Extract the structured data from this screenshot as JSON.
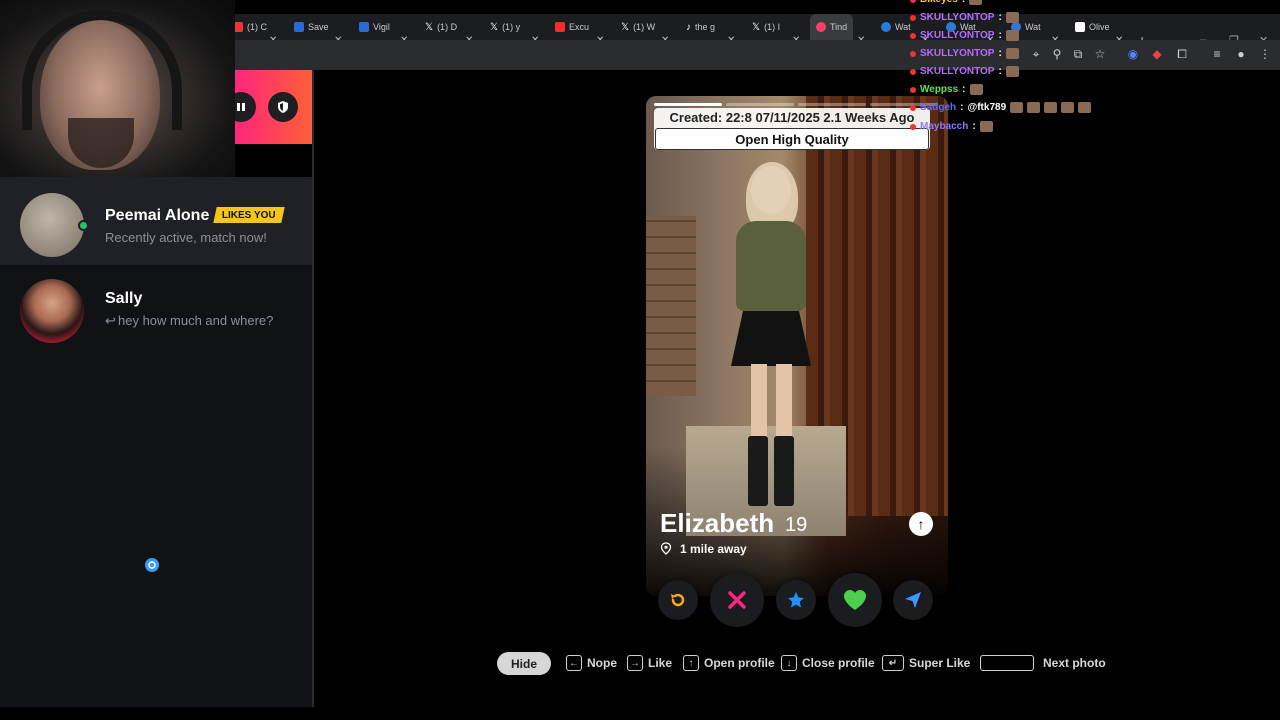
{
  "browser": {
    "tabs": [
      {
        "label": "(1) C",
        "favicon_color": "#e33"
      },
      {
        "label": "Save",
        "favicon_color": "#2a6ad6"
      },
      {
        "label": "Vigil",
        "favicon_color": "#2a6ad6"
      },
      {
        "label": "(1) D",
        "favicon_color": "#ffffff"
      },
      {
        "label": "(1) y",
        "favicon_color": "#ffffff"
      },
      {
        "label": "Excu",
        "favicon_color": "#ff2a2a"
      },
      {
        "label": "(1) W",
        "favicon_color": "#ffffff"
      },
      {
        "label": "the g",
        "favicon_color": "#111111"
      },
      {
        "label": "(1) I",
        "favicon_color": "#ffffff"
      },
      {
        "label": "Tind",
        "favicon_color": "#fe3c72"
      },
      {
        "label": "Wat",
        "favicon_color": "#2a7ad6"
      },
      {
        "label": "Wat",
        "favicon_color": "#2a7ad6"
      },
      {
        "label": "Wat",
        "favicon_color": "#2a7ad6"
      },
      {
        "label": "Olive",
        "favicon_color": "#ffffff"
      }
    ],
    "new_tab": "+",
    "window_controls": [
      "–",
      "❐",
      "✕"
    ]
  },
  "sidebar": {
    "matches": [
      {
        "name": "Peemai Alone",
        "badge": "LIKES YOU",
        "subtitle": "Recently active, match now!"
      },
      {
        "name": "Sally",
        "subtitle": "hey how much and where?"
      }
    ]
  },
  "profile": {
    "created": "Created: 22:8 07/11/2025 2.1 Weeks Ago",
    "open_hq": "Open High Quality",
    "name": "Elizabeth",
    "age": "19",
    "distance": "1 mile away",
    "photo_count": 4,
    "photo_index": 1
  },
  "actions": [
    "rewind",
    "nope",
    "super-like",
    "like",
    "boost"
  ],
  "shortcuts": {
    "hide": "Hide",
    "nope": "Nope",
    "like": "Like",
    "open_profile": "Open profile",
    "close_profile": "Close profile",
    "super_like": "Super Like",
    "next_photo": "Next photo"
  },
  "chat": [
    {
      "user": "Bikeyes",
      "msg": "",
      "color": "#ffd400"
    },
    {
      "user": "SKULLYONTOP",
      "msg": "",
      "color": "#b56cff"
    },
    {
      "user": "SKULLYONTOP",
      "msg": "",
      "color": "#b56cff"
    },
    {
      "user": "SKULLYONTOP",
      "msg": "",
      "color": "#b56cff"
    },
    {
      "user": "SKULLYONTOP",
      "msg": "",
      "color": "#b56cff"
    },
    {
      "user": "Weppss",
      "msg": "",
      "color": "#5be35b"
    },
    {
      "user": "Sadgeh",
      "msg": "@ftk789",
      "color": "#5a6bff"
    },
    {
      "user": "Maybacch",
      "msg": "",
      "color": "#8a7cff"
    }
  ],
  "colors": {
    "brand_gradient_start": "#fd267d",
    "brand_gradient_end": "#ff6036",
    "likes_badge": "#f5c518",
    "online": "#1ec56b",
    "nope": "#fd267d",
    "super_like": "#1e90ff",
    "like": "#4ad04a",
    "rewind": "#f5a623",
    "boost": "#3a9bff"
  }
}
